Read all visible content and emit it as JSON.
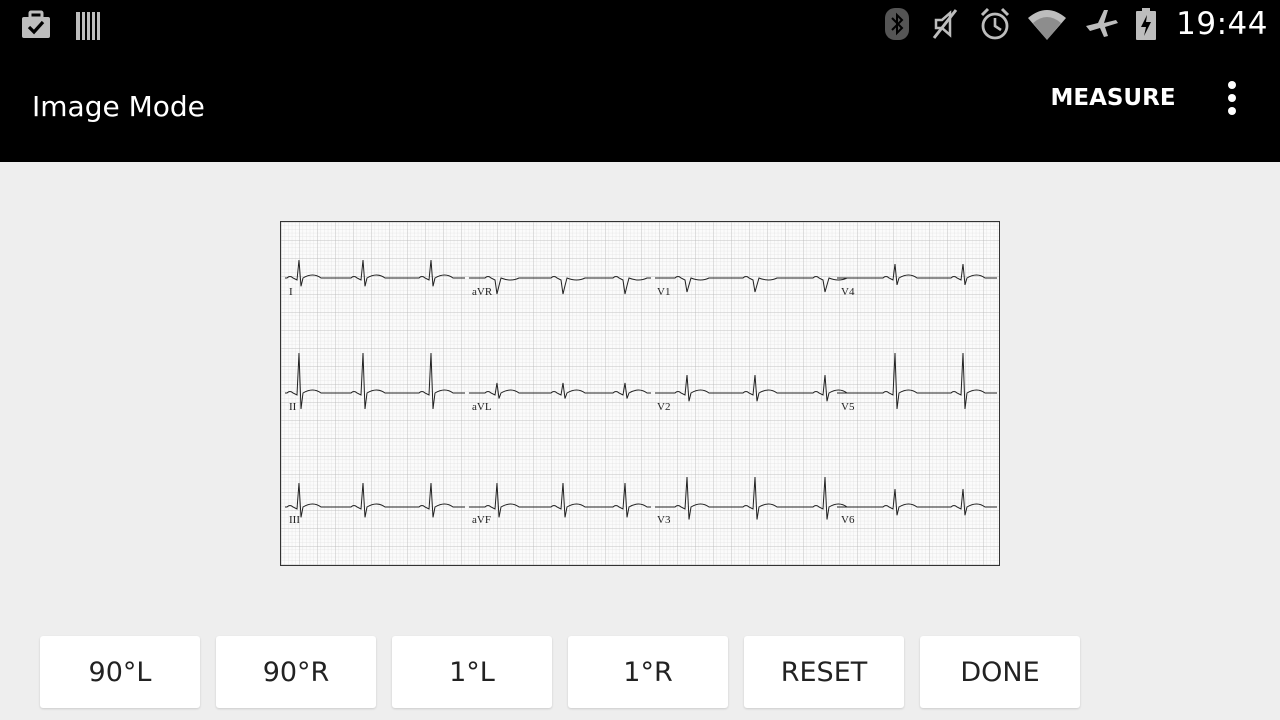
{
  "status_bar": {
    "time": "19:44",
    "left_icons": [
      "briefcase-check-icon",
      "barcode-icon"
    ],
    "right_icons": [
      "bluetooth-icon",
      "mute-icon",
      "alarm-icon",
      "wifi-icon",
      "airplane-icon",
      "battery-charging-icon"
    ]
  },
  "app_bar": {
    "title": "Image Mode",
    "measure_label": "MEASURE",
    "overflow_icon": "more-vert-icon"
  },
  "ecg": {
    "leads": [
      "I",
      "aVR",
      "V1",
      "V4",
      "II",
      "aVL",
      "V2",
      "V5",
      "III",
      "aVF",
      "V3",
      "V6"
    ]
  },
  "controls": {
    "rotate_left_90": "90°L",
    "rotate_right_90": "90°R",
    "rotate_left_1": "1°L",
    "rotate_right_1": "1°R",
    "reset": "RESET",
    "done": "DONE"
  }
}
